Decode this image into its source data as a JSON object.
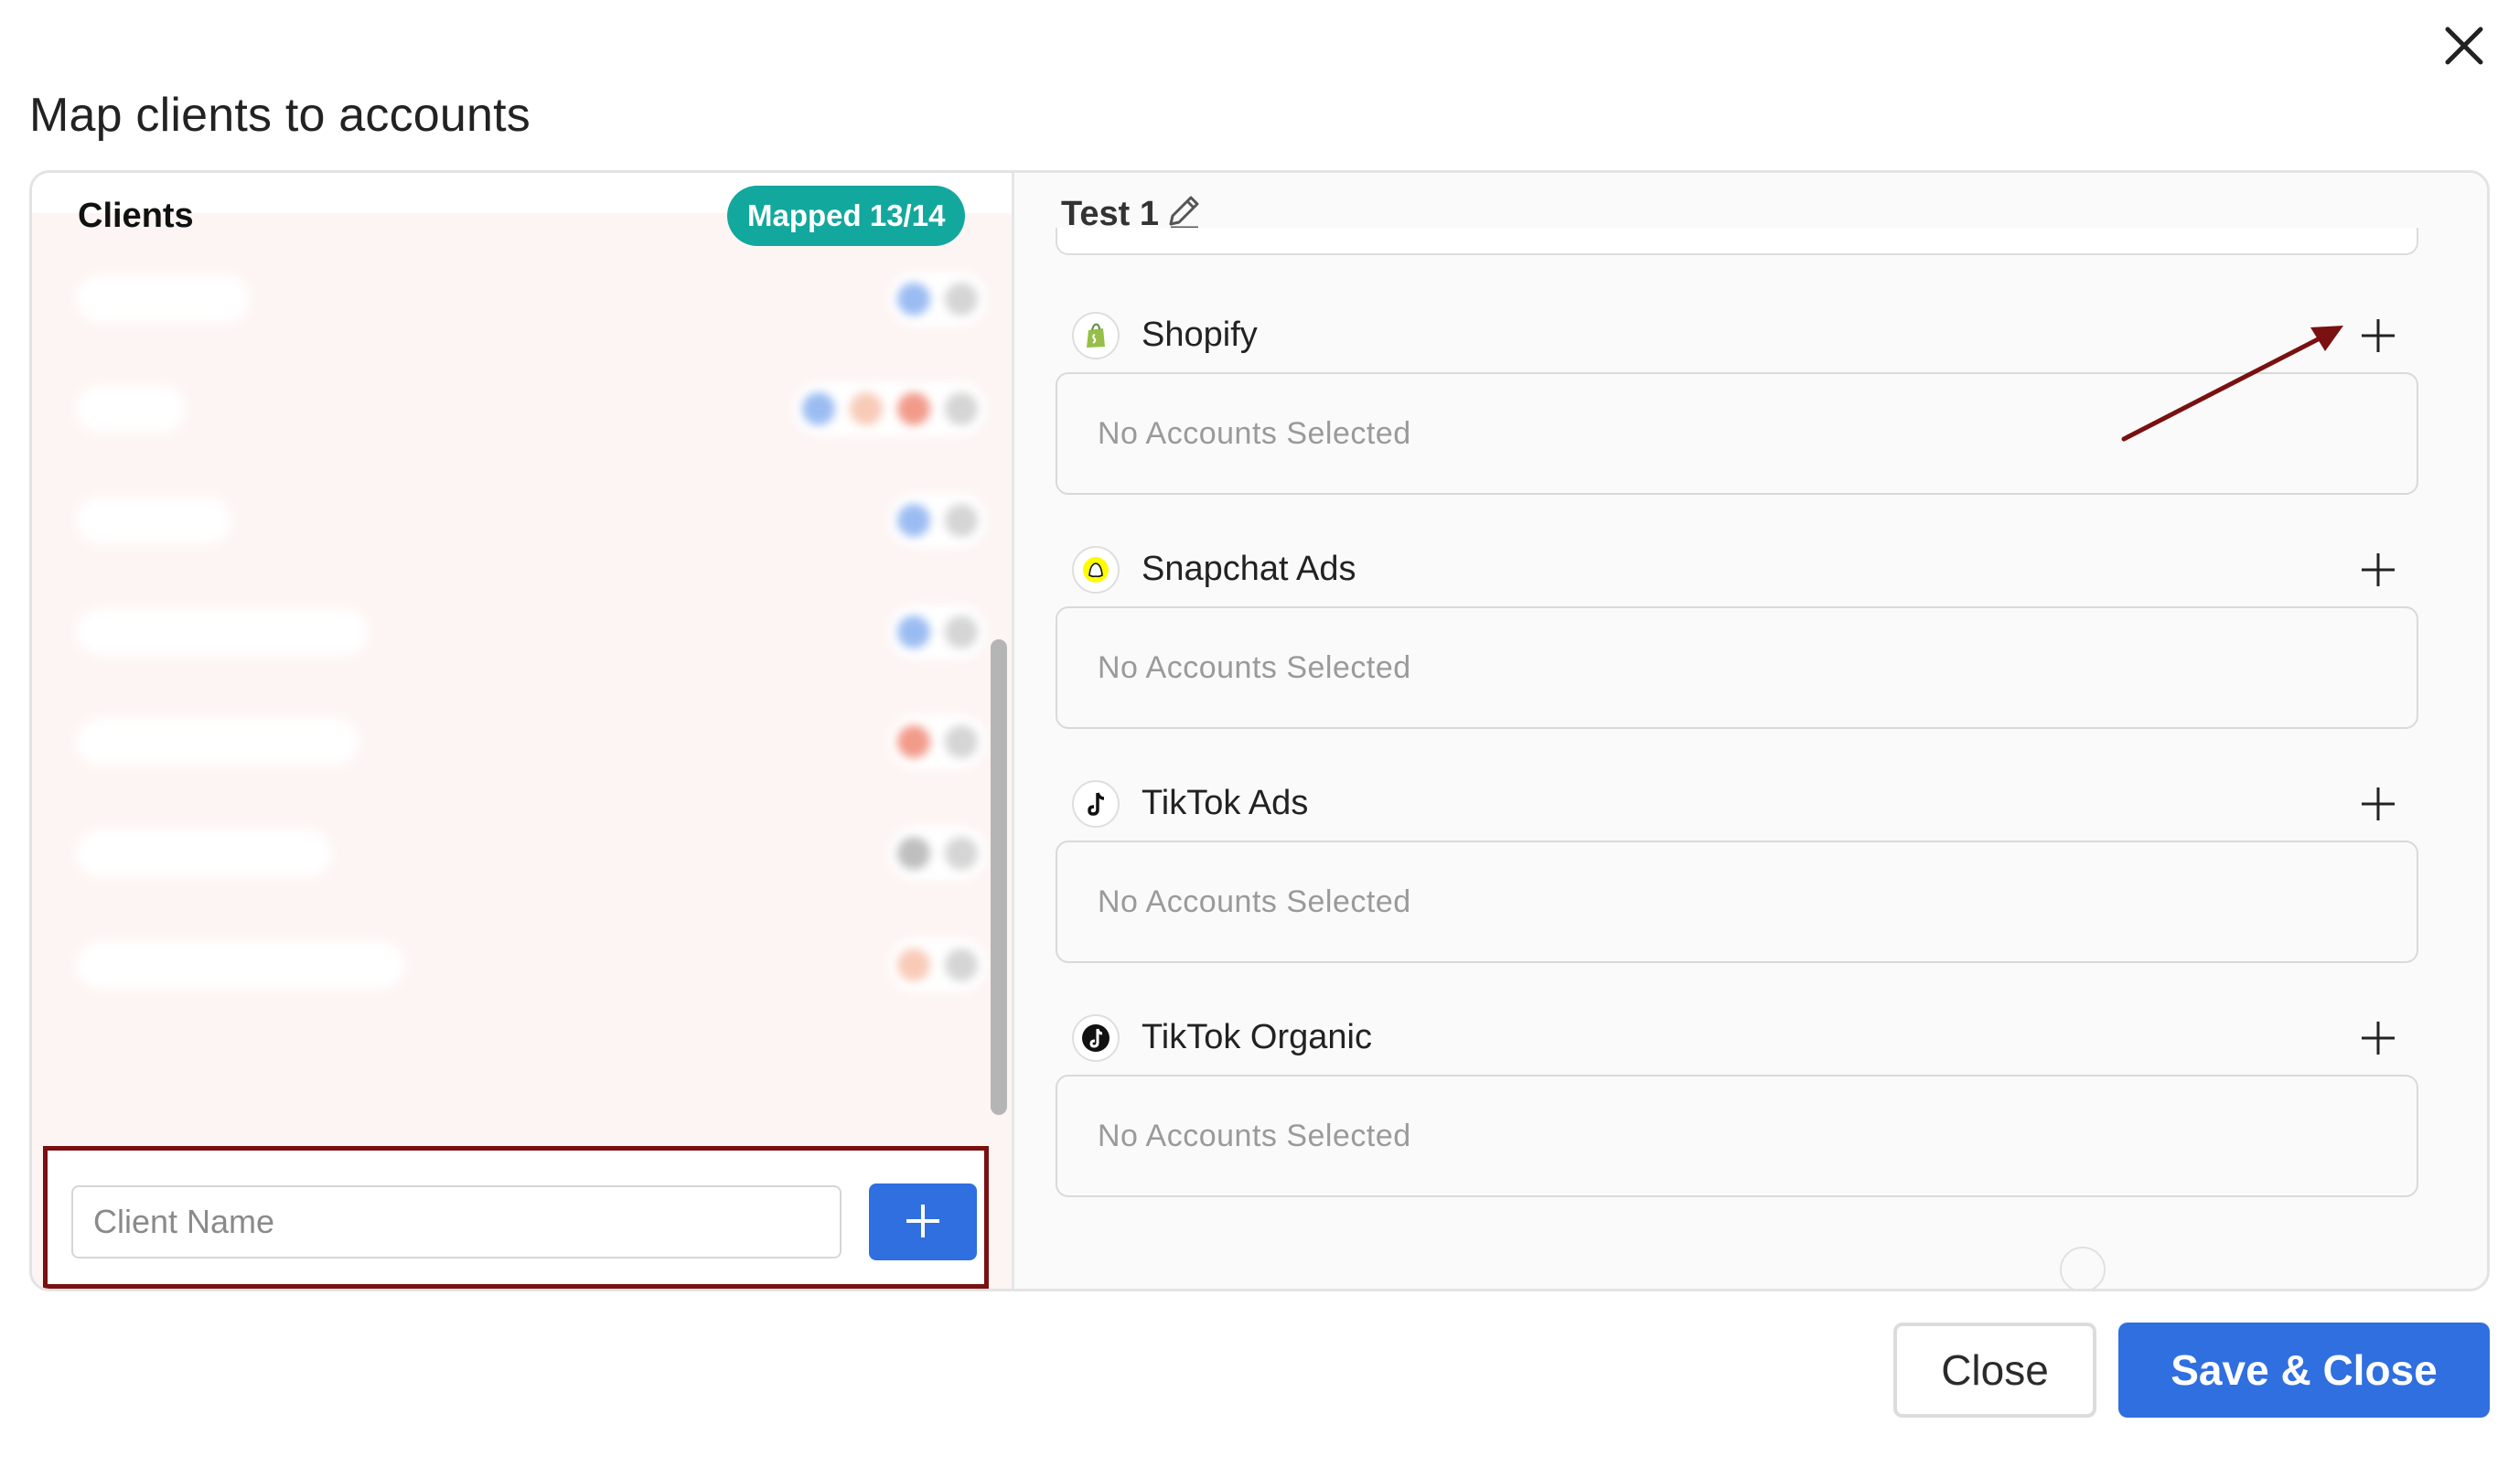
{
  "dialog": {
    "title": "Map clients to accounts",
    "close_icon": "close-icon"
  },
  "clients_panel": {
    "title": "Clients",
    "mapped_badge": "Mapped 13/14",
    "visible_client": "shopify",
    "new_client": {
      "placeholder": "Client Name",
      "value": ""
    },
    "add_icon": "plus-icon",
    "delete_icon": "trash-icon"
  },
  "group": {
    "name": "Test 1",
    "edit_icon": "pencil-icon"
  },
  "platforms": [
    {
      "name": "Shopify",
      "icon": "shopify-icon",
      "accounts": "No Accounts Selected"
    },
    {
      "name": "Snapchat Ads",
      "icon": "snapchat-icon",
      "accounts": "No Accounts Selected"
    },
    {
      "name": "TikTok Ads",
      "icon": "tiktok-icon",
      "accounts": "No Accounts Selected"
    },
    {
      "name": "TikTok Organic",
      "icon": "tiktok-icon",
      "accounts": "No Accounts Selected"
    }
  ],
  "footer": {
    "close_label": "Close",
    "save_label": "Save & Close"
  },
  "colors": {
    "accent_blue": "#2f6fe0",
    "badge_teal": "#13a89e",
    "annotation_red": "#7a1010"
  }
}
